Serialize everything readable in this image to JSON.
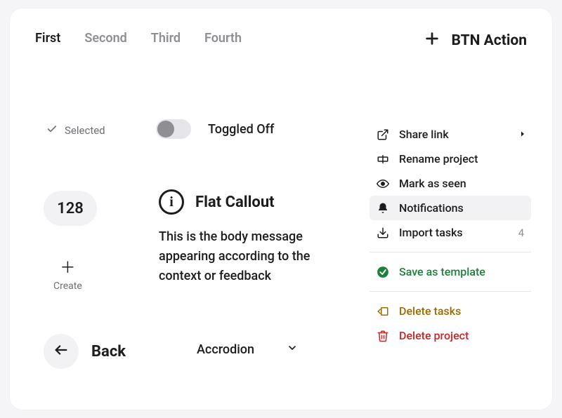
{
  "tabs": {
    "items": [
      "First",
      "Second",
      "Third",
      "Fourth"
    ],
    "active": 0
  },
  "btn_action": {
    "label": "BTN Action"
  },
  "selected": {
    "label": "Selected"
  },
  "toggle": {
    "label": "Toggled Off"
  },
  "badge": {
    "value": "128"
  },
  "create": {
    "label": "Create"
  },
  "callout": {
    "title": "Flat Callout",
    "body": "This is the body message appearing according to the context or feedback"
  },
  "back": {
    "label": "Back"
  },
  "accordion": {
    "label": "Accrodion"
  },
  "menu": {
    "share": {
      "label": "Share link"
    },
    "rename": {
      "label": "Rename project"
    },
    "seen": {
      "label": "Mark as seen"
    },
    "notifications": {
      "label": "Notifications"
    },
    "import": {
      "label": "Import tasks",
      "count": "4"
    },
    "save_template": {
      "label": "Save as template"
    },
    "delete_tasks": {
      "label": "Delete tasks"
    },
    "delete_project": {
      "label": "Delete project"
    }
  }
}
